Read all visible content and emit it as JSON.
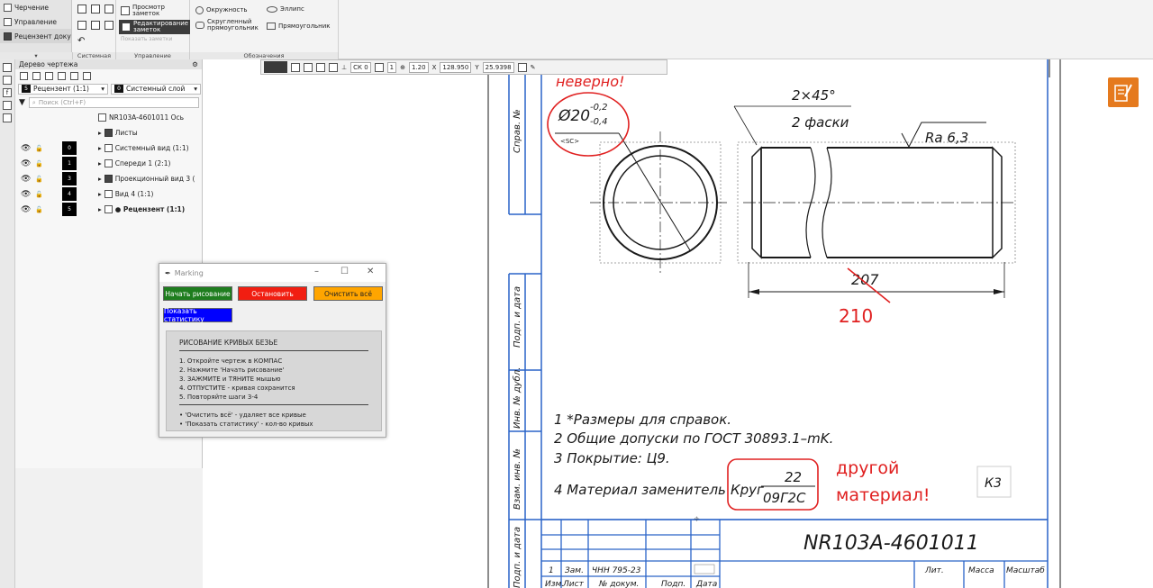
{
  "ribbon": {
    "left_items": [
      "Черчение",
      "Управление",
      "Рецензент документов К..."
    ],
    "buttons": {
      "preview_notes": "Просмотр заметок",
      "edit_notes": "Редактирование заметок",
      "disabled_hint": "Показать заметки",
      "circle": "Окружность",
      "ellipse": "Эллипс",
      "rounded_rect": "Скругленный прямоугольник",
      "rectangle": "Прямоугольник"
    },
    "groups": {
      "system": "Системная",
      "manage": "Управление",
      "notation": "Обозначения"
    }
  },
  "tree": {
    "title": "Дерево чертежа",
    "reviewer_select": "Рецензент (1:1)",
    "layer_select": "Системный слой",
    "layer_num": "0",
    "reviewer_num": "5",
    "search_placeholder": "Поиск (Ctrl+F)",
    "root": "NR103A-4601011 Ось",
    "sheets": "Листы",
    "rows": [
      {
        "num": "0",
        "label": "Системный вид (1:1)",
        "bold": false
      },
      {
        "num": "1",
        "label": "Спереди 1 (2:1)",
        "bold": false
      },
      {
        "num": "3",
        "label": "Проекционный вид 3 (",
        "bold": false
      },
      {
        "num": "4",
        "label": "Вид 4 (1:1)",
        "bold": false
      },
      {
        "num": "5",
        "label": "● Рецензент (1:1)",
        "bold": true
      }
    ]
  },
  "view_toolbar": {
    "style": "СК 0",
    "step": "1",
    "zoom": "1.20",
    "x_label": "X",
    "x_value": "128.950",
    "y_label": "Y",
    "y_value": "25.9398"
  },
  "dialog": {
    "title": "Marking",
    "start_btn": "Начать рисование",
    "stop_btn": "Остановить",
    "clear_btn": "Очистить всё",
    "stats_btn": "Показать статистику",
    "heading": "РИСОВАНИЕ КРИВЫХ БЕЗЬЕ",
    "steps": [
      "1. Откройте чертеж в КОМПАС",
      "2. Нажмите 'Начать рисование'",
      "3. ЗАЖМИТЕ и ТЯНИТЕ мышью",
      "4. ОТПУСТИТЕ - кривая сохранится",
      "5. Повторяйте шаги 3-4"
    ],
    "notes": [
      "• 'Очистить всё' - удаляет все кривые",
      "• 'Показать статистику' - кол-во кривых"
    ],
    "colors": {
      "start": "#1e7d1e",
      "stop": "#f11e11",
      "clear": "#ffa500",
      "stats": "#0000ff"
    }
  },
  "drawing": {
    "frame_labels": [
      "Справ. №",
      "Подп. и дата",
      "Инв. № дубл.",
      "Взам. инв. №",
      "Подп. и дата"
    ],
    "dia": "Ø20",
    "tol_upper": "-0,2",
    "tol_lower": "-0,4",
    "tol_tag": "<SC>",
    "chamfer": "2×45°",
    "chamfer_count": "2 фаски",
    "roughness": "Ra 6,3",
    "length_old": "207",
    "length_new": "210",
    "notes": [
      "1  *Размеры для справок.",
      "2  Общие допуски по ГОСТ 30893.1–mK.",
      "3  Покрытие: Ц9.",
      "4  Материал заменитель"
    ],
    "material_label": "Круг",
    "material_num": "22",
    "material_grade": "09Г2С",
    "annot_material": [
      "другой",
      "материал!"
    ],
    "annot_top": "неверно!",
    "k3": "К3",
    "designation": "NR103A-4601011",
    "stamp_row": [
      "1",
      "Зам.",
      "ЧНН 795-23",
      "",
      ""
    ],
    "stamp_headers": [
      "Изм.",
      "Лист",
      "№ докум.",
      "Подп.",
      "Дата"
    ],
    "stamp_right": [
      "Лит.",
      "Масса",
      "Масштаб"
    ],
    "colors": {
      "frame": "#2a64c8",
      "markup": "#e02020",
      "ink": "#1a1a1a"
    }
  }
}
